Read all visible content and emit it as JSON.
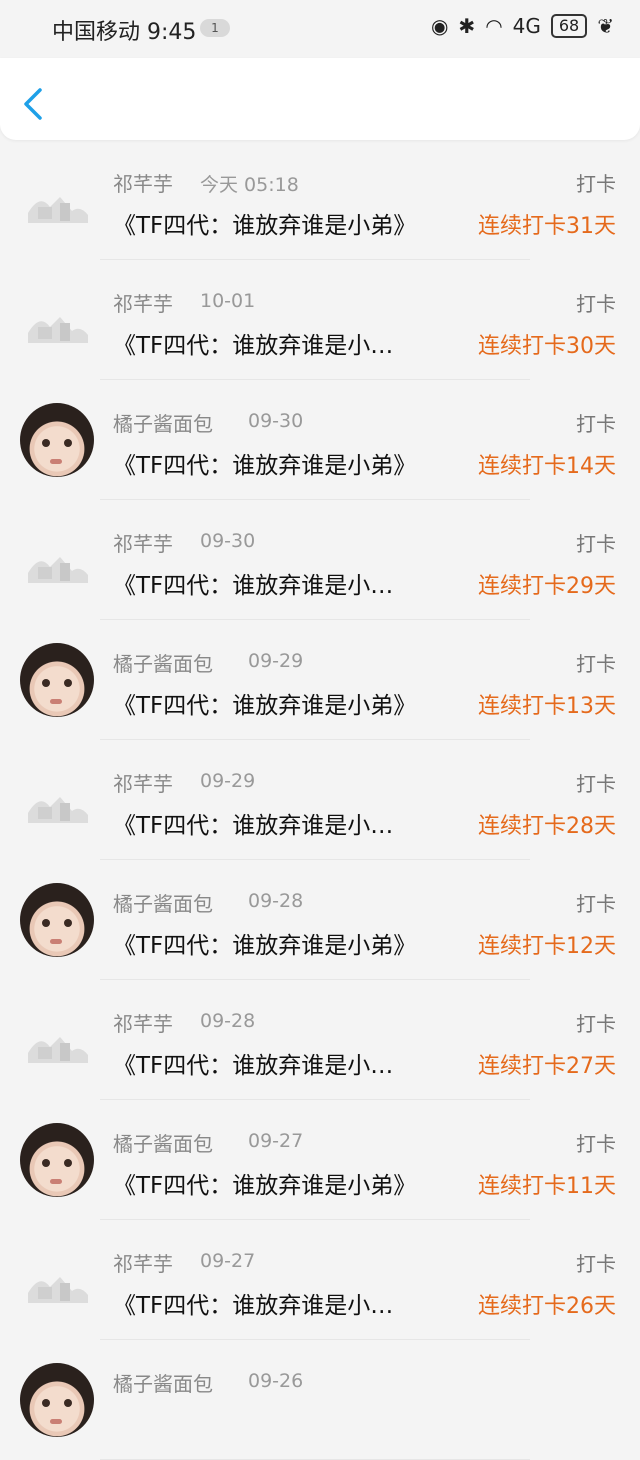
{
  "status_bar": {
    "carrier_time": "中国移动 9:45",
    "pill": "1",
    "network": "4G",
    "battery": "68"
  },
  "items": [
    {
      "name": "祁芊芋",
      "time": "今天 05:18",
      "type": "打卡",
      "title": "《TF四代：谁放弃谁是小弟》",
      "streak": "连续打卡31天",
      "avatar": "placeholder"
    },
    {
      "name": "祁芊芋",
      "time": "10-01",
      "type": "打卡",
      "title": "《TF四代：谁放弃谁是小…",
      "streak": "连续打卡30天",
      "avatar": "placeholder"
    },
    {
      "name": "橘子酱面包",
      "time": "09-30",
      "type": "打卡",
      "title": "《TF四代：谁放弃谁是小弟》",
      "streak": "连续打卡14天",
      "avatar": "photo"
    },
    {
      "name": "祁芊芋",
      "time": "09-30",
      "type": "打卡",
      "title": "《TF四代：谁放弃谁是小…",
      "streak": "连续打卡29天",
      "avatar": "placeholder"
    },
    {
      "name": "橘子酱面包",
      "time": "09-29",
      "type": "打卡",
      "title": "《TF四代：谁放弃谁是小弟》",
      "streak": "连续打卡13天",
      "avatar": "photo"
    },
    {
      "name": "祁芊芋",
      "time": "09-29",
      "type": "打卡",
      "title": "《TF四代：谁放弃谁是小…",
      "streak": "连续打卡28天",
      "avatar": "placeholder"
    },
    {
      "name": "橘子酱面包",
      "time": "09-28",
      "type": "打卡",
      "title": "《TF四代：谁放弃谁是小弟》",
      "streak": "连续打卡12天",
      "avatar": "photo"
    },
    {
      "name": "祁芊芋",
      "time": "09-28",
      "type": "打卡",
      "title": "《TF四代：谁放弃谁是小…",
      "streak": "连续打卡27天",
      "avatar": "placeholder"
    },
    {
      "name": "橘子酱面包",
      "time": "09-27",
      "type": "打卡",
      "title": "《TF四代：谁放弃谁是小弟》",
      "streak": "连续打卡11天",
      "avatar": "photo"
    },
    {
      "name": "祁芊芋",
      "time": "09-27",
      "type": "打卡",
      "title": "《TF四代：谁放弃谁是小…",
      "streak": "连续打卡26天",
      "avatar": "placeholder"
    },
    {
      "name": "橘子酱面包",
      "time": "09-26",
      "type": "",
      "title": "",
      "streak": "",
      "avatar": "photo"
    }
  ],
  "colors": {
    "accent": "#1ea0e8",
    "streak": "#e56a1c"
  }
}
